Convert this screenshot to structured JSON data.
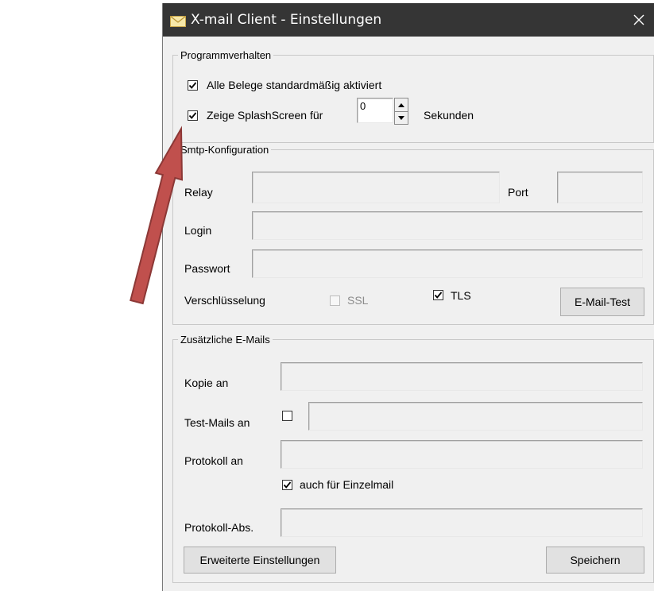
{
  "window": {
    "title": "X-mail Client - Einstellungen",
    "close_glyph": "✕",
    "title_color": "#353535",
    "title_icon": "envelope-icon",
    "arrow_color": "#c0504d"
  },
  "programmverhalten": {
    "legend": "Programmverhalten",
    "all_receipts": {
      "label": "Alle Belege standardmäßig aktiviert",
      "checked": true
    },
    "splash": {
      "label": "Zeige SplashScreen für",
      "checked": true,
      "value": "0",
      "unit": "Sekunden"
    }
  },
  "smtp": {
    "legend": "Smtp-Konfiguration",
    "relay_label": "Relay",
    "relay_value": "",
    "port_label": "Port",
    "port_value": "",
    "login_label": "Login",
    "login_value": "",
    "password_label": "Passwort",
    "password_value": "",
    "encryption_label": "Verschlüsselung",
    "ssl": {
      "label": "SSL",
      "checked": false,
      "enabled": false
    },
    "tls": {
      "label": "TLS",
      "checked": true,
      "enabled": true
    },
    "test_button": "E-Mail-Test"
  },
  "extra": {
    "legend": "Zusätzliche E-Mails",
    "copy_label": "Kopie an",
    "copy_value": "",
    "test_label": "Test-Mails an",
    "test_checked": false,
    "test_value": "",
    "protocol_label": "Protokoll an",
    "protocol_value": "",
    "single_mail": {
      "label": "auch für Einzelmail",
      "checked": true
    },
    "protocol_sender_label": "Protokoll-Abs.",
    "protocol_sender_value": ""
  },
  "footer": {
    "advanced_button": "Erweiterte Einstellungen",
    "save_button": "Speichern"
  }
}
